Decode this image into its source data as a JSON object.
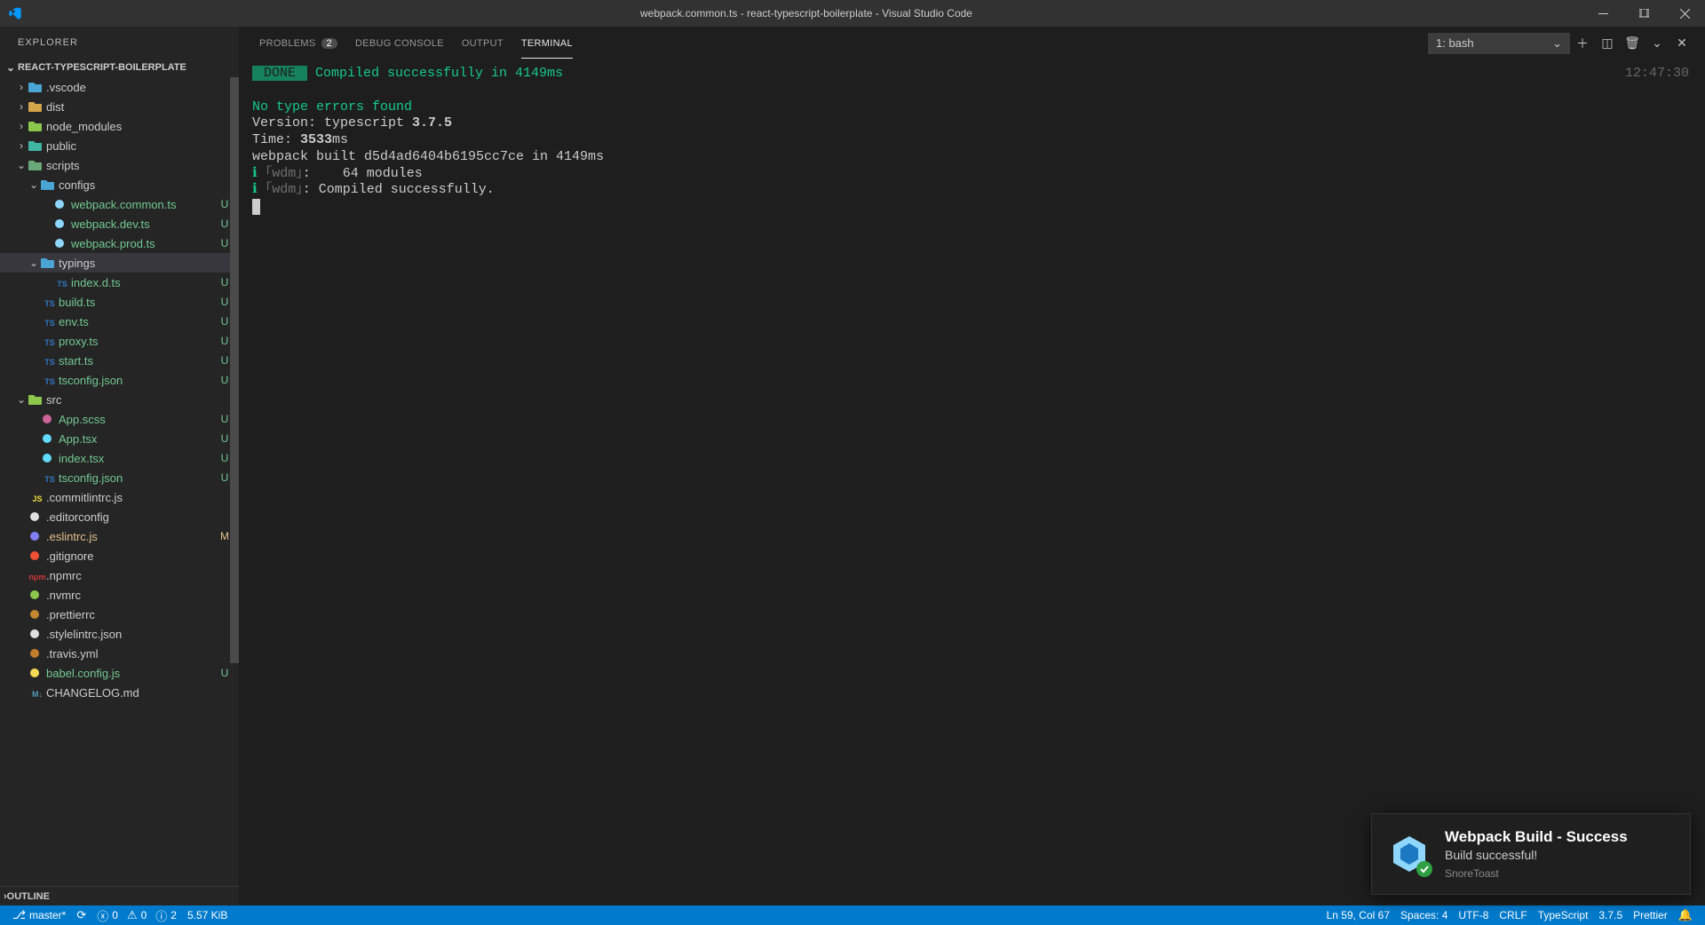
{
  "window": {
    "title": "webpack.common.ts - react-typescript-boilerplate - Visual Studio Code"
  },
  "explorer": {
    "title": "EXPLORER",
    "project": "REACT-TYPESCRIPT-BOILERPLATE",
    "outline": "OUTLINE"
  },
  "tree": [
    {
      "depth": 0,
      "chev": ">",
      "icon": "folder-vscode",
      "name": ".vscode",
      "git": "dot"
    },
    {
      "depth": 0,
      "chev": ">",
      "icon": "folder-dist",
      "name": "dist"
    },
    {
      "depth": 0,
      "chev": ">",
      "icon": "folder-node",
      "name": "node_modules"
    },
    {
      "depth": 0,
      "chev": ">",
      "icon": "folder-public",
      "name": "public",
      "git": "dot"
    },
    {
      "depth": 0,
      "chev": "v",
      "icon": "folder-scripts",
      "name": "scripts",
      "git": "dot"
    },
    {
      "depth": 1,
      "chev": "v",
      "icon": "folder-config",
      "name": "configs",
      "git": "dot"
    },
    {
      "depth": 2,
      "chev": "",
      "icon": "webpack",
      "name": "webpack.common.ts",
      "git": "U"
    },
    {
      "depth": 2,
      "chev": "",
      "icon": "webpack",
      "name": "webpack.dev.ts",
      "git": "U"
    },
    {
      "depth": 2,
      "chev": "",
      "icon": "webpack",
      "name": "webpack.prod.ts",
      "git": "U"
    },
    {
      "depth": 1,
      "chev": "v",
      "icon": "folder-ts",
      "name": "typings",
      "git": "dot",
      "selected": true
    },
    {
      "depth": 2,
      "chev": "",
      "icon": "ts-file",
      "name": "index.d.ts",
      "git": "U"
    },
    {
      "depth": 1,
      "chev": "",
      "icon": "ts-file",
      "name": "build.ts",
      "git": "U"
    },
    {
      "depth": 1,
      "chev": "",
      "icon": "ts-file",
      "name": "env.ts",
      "git": "U"
    },
    {
      "depth": 1,
      "chev": "",
      "icon": "ts-file",
      "name": "proxy.ts",
      "git": "U"
    },
    {
      "depth": 1,
      "chev": "",
      "icon": "ts-file",
      "name": "start.ts",
      "git": "U"
    },
    {
      "depth": 1,
      "chev": "",
      "icon": "tsconfig",
      "name": "tsconfig.json",
      "git": "U"
    },
    {
      "depth": 0,
      "chev": "v",
      "icon": "folder-src",
      "name": "src",
      "git": "dot"
    },
    {
      "depth": 1,
      "chev": "",
      "icon": "scss",
      "name": "App.scss",
      "git": "U"
    },
    {
      "depth": 1,
      "chev": "",
      "icon": "react",
      "name": "App.tsx",
      "git": "U"
    },
    {
      "depth": 1,
      "chev": "",
      "icon": "react",
      "name": "index.tsx",
      "git": "U"
    },
    {
      "depth": 1,
      "chev": "",
      "icon": "tsconfig",
      "name": "tsconfig.json",
      "git": "U"
    },
    {
      "depth": 0,
      "chev": "",
      "icon": "js",
      "name": ".commitlintrc.js"
    },
    {
      "depth": 0,
      "chev": "",
      "icon": "editorconfig",
      "name": ".editorconfig"
    },
    {
      "depth": 0,
      "chev": "",
      "icon": "eslint",
      "name": ".eslintrc.js",
      "git": "M"
    },
    {
      "depth": 0,
      "chev": "",
      "icon": "git",
      "name": ".gitignore"
    },
    {
      "depth": 0,
      "chev": "",
      "icon": "npm",
      "name": ".npmrc"
    },
    {
      "depth": 0,
      "chev": "",
      "icon": "node",
      "name": ".nvmrc"
    },
    {
      "depth": 0,
      "chev": "",
      "icon": "prettier",
      "name": ".prettierrc"
    },
    {
      "depth": 0,
      "chev": "",
      "icon": "stylelint",
      "name": ".stylelintrc.json"
    },
    {
      "depth": 0,
      "chev": "",
      "icon": "travis",
      "name": ".travis.yml"
    },
    {
      "depth": 0,
      "chev": "",
      "icon": "babel",
      "name": "babel.config.js",
      "git": "U"
    },
    {
      "depth": 0,
      "chev": "",
      "icon": "md",
      "name": "CHANGELOG.md"
    }
  ],
  "panel": {
    "tabs": {
      "problems": "PROBLEMS",
      "problems_count": "2",
      "debug": "DEBUG CONSOLE",
      "output": "OUTPUT",
      "terminal": "TERMINAL"
    },
    "terminal_select": "1: bash"
  },
  "terminal": {
    "timestamp": "12:47:30",
    "done_label": " DONE ",
    "done_msg": " Compiled successfully in 4149ms",
    "no_errors": "No type errors found",
    "version_prefix": "Version: typescript ",
    "version": "3.7.5",
    "time_prefix": "Time: ",
    "time_bold": "3533",
    "time_suffix": "ms",
    "build_line": "webpack built d5d4ad6404b6195cc7ce in 4149ms",
    "wdm1": ":    64 modules",
    "wdm2": ": Compiled successfully.",
    "wdm_tag": "｢wdm｣",
    "i": "ℹ"
  },
  "toast": {
    "title": "Webpack Build - Success",
    "sub": "Build successful!",
    "app": "SnoreToast"
  },
  "status": {
    "branch": "master*",
    "err": "0",
    "warn": "0",
    "info": "2",
    "size": "5.57 KiB",
    "pos": "Ln 59, Col 67",
    "spaces": "Spaces: 4",
    "enc": "UTF-8",
    "eol": "CRLF",
    "lang": "TypeScript",
    "ts_ver": "3.7.5",
    "prettier": "Prettier"
  },
  "icon_colors": {
    "folder-vscode": "#4aa4d4",
    "folder-dist": "#d4a54a",
    "folder-node": "#8cc84b",
    "folder-public": "#3fb6a3",
    "folder-scripts": "#6aa87a",
    "folder-config": "#4aa4d4",
    "folder-ts": "#4aa4d4",
    "folder-src": "#8cc84b",
    "webpack": "#8ed6fb",
    "ts-file": "#3178c6",
    "tsconfig": "#3178c6",
    "scss": "#cf649a",
    "react": "#61dafb",
    "js": "#f1dd3f",
    "editorconfig": "#e0e0e0",
    "eslint": "#8080f2",
    "git": "#f05033",
    "npm": "#cb3837",
    "node": "#8cc84b",
    "prettier": "#c3882f",
    "stylelint": "#e0e0e0",
    "travis": "#c37b2c",
    "babel": "#f5da55",
    "md": "#519aba"
  },
  "icon_labels": {
    "js": "JS",
    "ts-file": "TS",
    "tsconfig": "TS",
    "npm": "npm",
    "md": "M↓"
  }
}
